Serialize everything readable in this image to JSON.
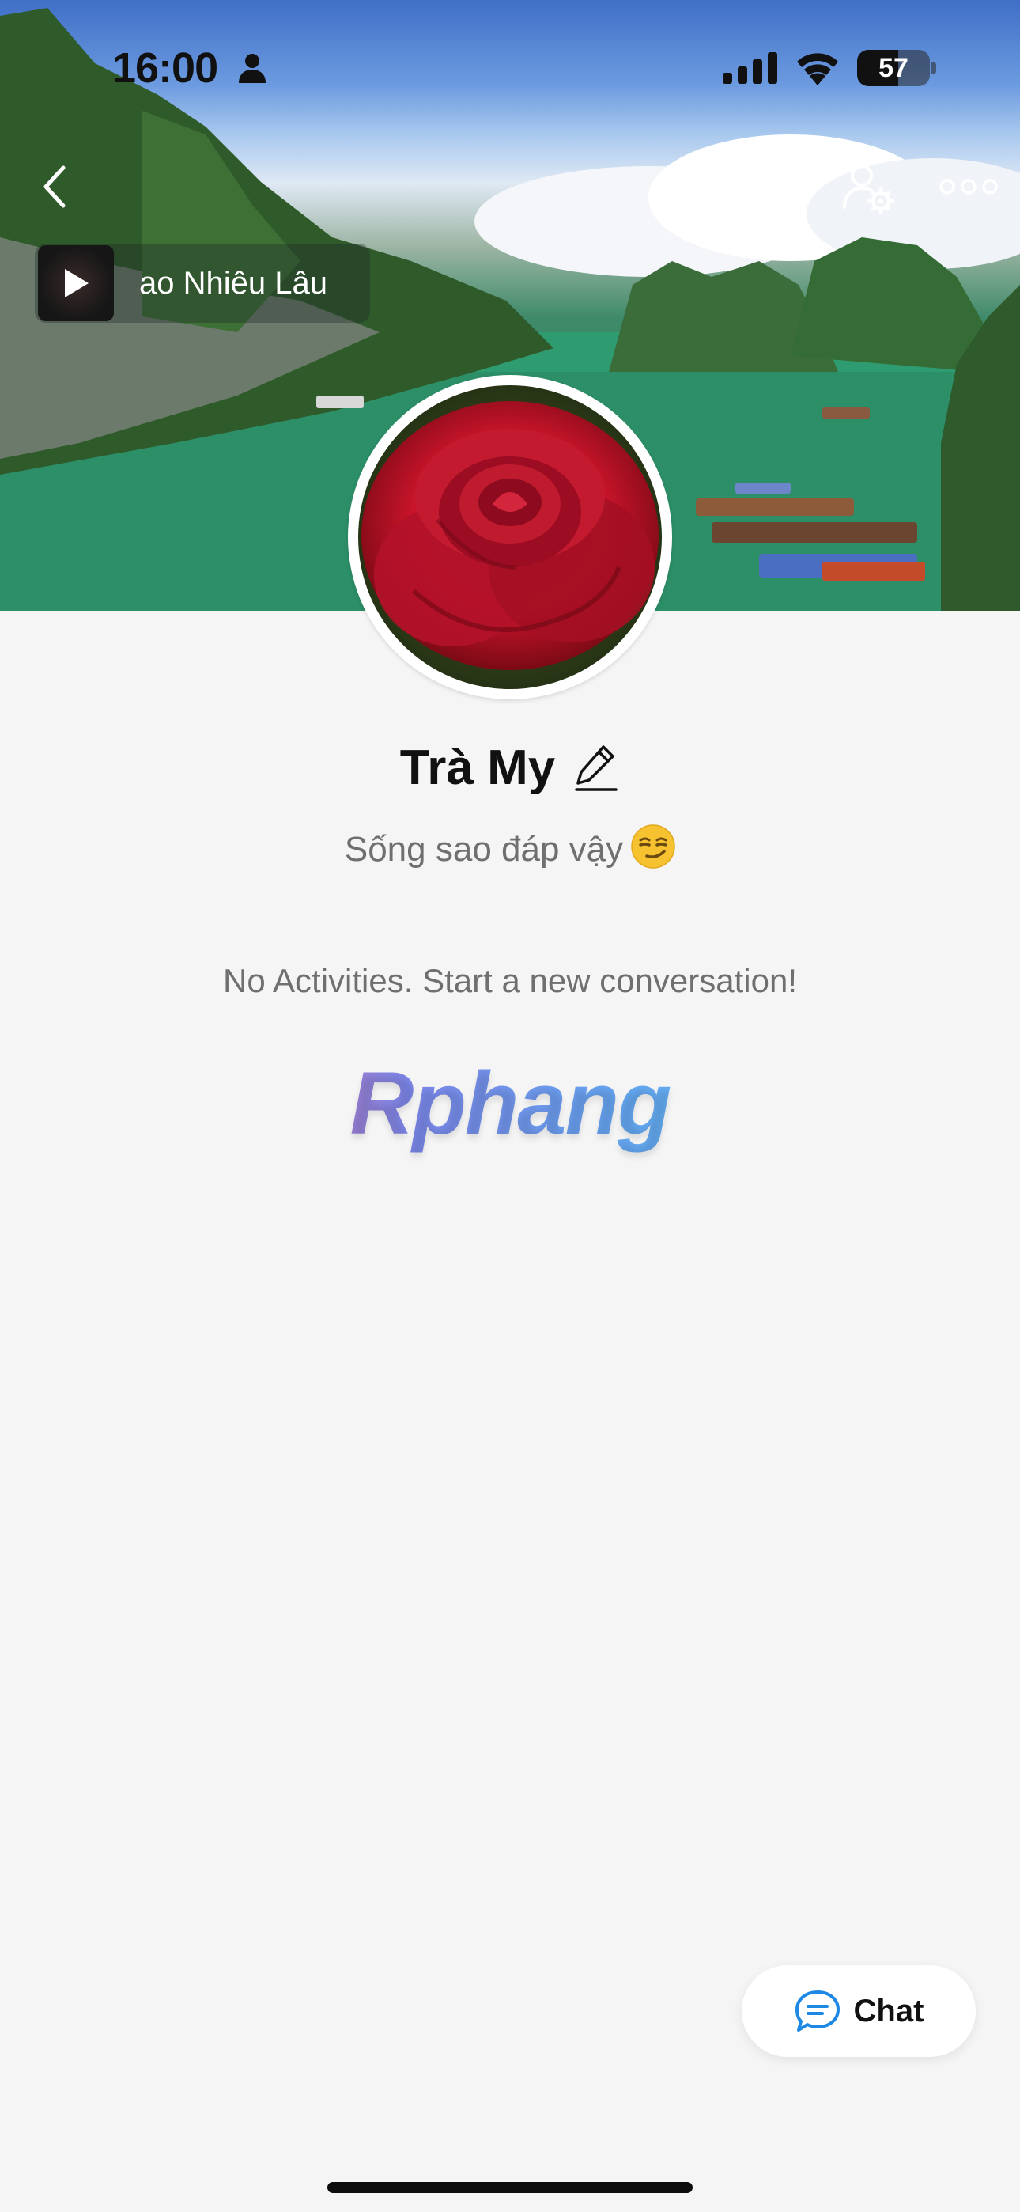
{
  "status_bar": {
    "time": "16:00",
    "battery_level": "57",
    "battery_fraction": 0.57
  },
  "nav": {
    "back_icon": "chevron-left-icon",
    "call_icon": "phone-icon",
    "settings_icon": "user-settings-icon",
    "more_icon": "more-horizontal-icon"
  },
  "music": {
    "title": "ao Nhiêu Lâu",
    "icon": "play-icon"
  },
  "profile": {
    "name": "Trà My",
    "status": "Sống sao đáp vậy",
    "status_emoji": "smirk-emoji",
    "edit_icon": "pencil-icon"
  },
  "feed": {
    "empty_message": "No Activities. Start a new conversation!"
  },
  "watermark": {
    "text": "Rphang"
  },
  "chat_button": {
    "label": "Chat",
    "icon": "chat-bubble-icon",
    "accent": "#1e88e5"
  },
  "colors": {
    "background": "#f5f5f5",
    "text_primary": "#111111",
    "text_secondary": "#6f6f6f"
  }
}
